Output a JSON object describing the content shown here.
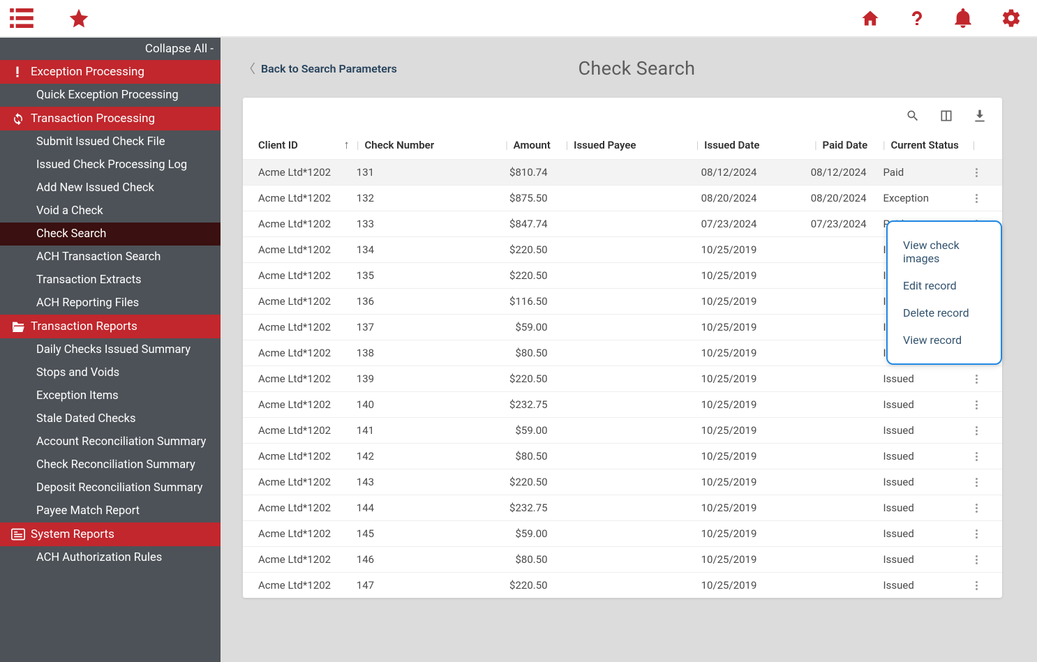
{
  "topbar": {
    "icons": [
      "list-icon",
      "star-icon",
      "home-icon",
      "help-icon",
      "bell-icon",
      "gear-icon"
    ]
  },
  "sidebar": {
    "collapse_all": "Collapse All -",
    "sections": [
      {
        "label": "Exception Processing",
        "icon": "exclamation-icon",
        "items": [
          "Quick Exception Processing"
        ]
      },
      {
        "label": "Transaction Processing",
        "icon": "refresh-icon",
        "items": [
          "Submit Issued Check File",
          "Issued Check Processing Log",
          "Add New Issued Check",
          "Void a Check",
          "Check Search",
          "ACH Transaction Search",
          "Transaction Extracts",
          "ACH Reporting Files"
        ],
        "active": "Check Search"
      },
      {
        "label": "Transaction Reports",
        "icon": "folder-open-icon",
        "items": [
          "Daily Checks Issued Summary",
          "Stops and Voids",
          "Exception Items",
          "Stale Dated Checks",
          "Account Reconciliation Summary",
          "Check Reconciliation Summary",
          "Deposit Reconciliation Summary",
          "Payee Match Report"
        ]
      },
      {
        "label": "System Reports",
        "icon": "report-icon",
        "items": [
          "ACH Authorization Rules"
        ]
      }
    ]
  },
  "page": {
    "title": "Check Search",
    "back": "Back to Search Parameters"
  },
  "table": {
    "headers": {
      "client": "Client ID",
      "check": "Check Number",
      "amount": "Amount",
      "payee": "Issued Payee",
      "idate": "Issued Date",
      "pdate": "Paid Date",
      "status": "Current Status"
    },
    "rows": [
      {
        "client": "Acme Ltd*1202",
        "check": "131",
        "amount": "$810.74",
        "payee": "",
        "idate": "08/12/2024",
        "pdate": "08/12/2024",
        "status": "Paid"
      },
      {
        "client": "Acme Ltd*1202",
        "check": "132",
        "amount": "$875.50",
        "payee": "",
        "idate": "08/20/2024",
        "pdate": "08/20/2024",
        "status": "Exception"
      },
      {
        "client": "Acme Ltd*1202",
        "check": "133",
        "amount": "$847.74",
        "payee": "",
        "idate": "07/23/2024",
        "pdate": "07/23/2024",
        "status": "Paid"
      },
      {
        "client": "Acme Ltd*1202",
        "check": "134",
        "amount": "$220.50",
        "payee": "",
        "idate": "10/25/2019",
        "pdate": "",
        "status": "Issued"
      },
      {
        "client": "Acme Ltd*1202",
        "check": "135",
        "amount": "$220.50",
        "payee": "",
        "idate": "10/25/2019",
        "pdate": "",
        "status": "Issued"
      },
      {
        "client": "Acme Ltd*1202",
        "check": "136",
        "amount": "$116.50",
        "payee": "",
        "idate": "10/25/2019",
        "pdate": "",
        "status": "Issued"
      },
      {
        "client": "Acme Ltd*1202",
        "check": "137",
        "amount": "$59.00",
        "payee": "",
        "idate": "10/25/2019",
        "pdate": "",
        "status": "Issued"
      },
      {
        "client": "Acme Ltd*1202",
        "check": "138",
        "amount": "$80.50",
        "payee": "",
        "idate": "10/25/2019",
        "pdate": "",
        "status": "Issued"
      },
      {
        "client": "Acme Ltd*1202",
        "check": "139",
        "amount": "$220.50",
        "payee": "",
        "idate": "10/25/2019",
        "pdate": "",
        "status": "Issued"
      },
      {
        "client": "Acme Ltd*1202",
        "check": "140",
        "amount": "$232.75",
        "payee": "",
        "idate": "10/25/2019",
        "pdate": "",
        "status": "Issued"
      },
      {
        "client": "Acme Ltd*1202",
        "check": "141",
        "amount": "$59.00",
        "payee": "",
        "idate": "10/25/2019",
        "pdate": "",
        "status": "Issued"
      },
      {
        "client": "Acme Ltd*1202",
        "check": "142",
        "amount": "$80.50",
        "payee": "",
        "idate": "10/25/2019",
        "pdate": "",
        "status": "Issued"
      },
      {
        "client": "Acme Ltd*1202",
        "check": "143",
        "amount": "$220.50",
        "payee": "",
        "idate": "10/25/2019",
        "pdate": "",
        "status": "Issued"
      },
      {
        "client": "Acme Ltd*1202",
        "check": "144",
        "amount": "$232.75",
        "payee": "",
        "idate": "10/25/2019",
        "pdate": "",
        "status": "Issued"
      },
      {
        "client": "Acme Ltd*1202",
        "check": "145",
        "amount": "$59.00",
        "payee": "",
        "idate": "10/25/2019",
        "pdate": "",
        "status": "Issued"
      },
      {
        "client": "Acme Ltd*1202",
        "check": "146",
        "amount": "$80.50",
        "payee": "",
        "idate": "10/25/2019",
        "pdate": "",
        "status": "Issued"
      },
      {
        "client": "Acme Ltd*1202",
        "check": "147",
        "amount": "$220.50",
        "payee": "",
        "idate": "10/25/2019",
        "pdate": "",
        "status": "Issued"
      }
    ]
  },
  "context_menu": {
    "items": [
      "View check images",
      "Edit record",
      "Delete record",
      "View record"
    ]
  }
}
